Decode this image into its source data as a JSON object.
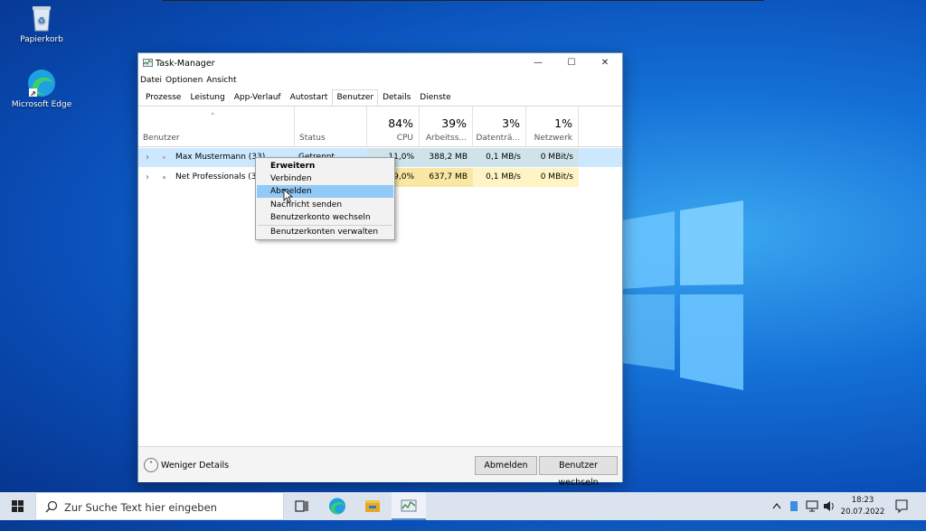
{
  "desktop": {
    "icons": [
      {
        "label": "Papierkorb"
      },
      {
        "label": "Microsoft Edge"
      }
    ]
  },
  "window": {
    "title": "Task-Manager",
    "controls": {
      "minimize": "—",
      "maximize": "☐",
      "close": "✕"
    }
  },
  "menu": [
    "Datei",
    "Optionen",
    "Ansicht"
  ],
  "tabs": [
    {
      "label": "Prozesse",
      "active": false
    },
    {
      "label": "Leistung",
      "active": false
    },
    {
      "label": "App-Verlauf",
      "active": false
    },
    {
      "label": "Autostart",
      "active": false
    },
    {
      "label": "Benutzer",
      "active": true
    },
    {
      "label": "Details",
      "active": false
    },
    {
      "label": "Dienste",
      "active": false
    }
  ],
  "columns": {
    "user": "Benutzer",
    "status": "Status",
    "cpu": {
      "percent": "84%",
      "label": "CPU"
    },
    "memory": {
      "percent": "39%",
      "label": "Arbeitss..."
    },
    "disk": {
      "percent": "3%",
      "label": "Datenträ..."
    },
    "network": {
      "percent": "1%",
      "label": "Netzwerk"
    }
  },
  "rows": [
    {
      "name": "Max Mustermann (33)",
      "status": "Getrennt",
      "cpu": "11,0%",
      "memory": "388,2 MB",
      "disk": "0,1 MB/s",
      "network": "0 MBit/s"
    },
    {
      "name": "Net Professionals (30)",
      "status": "",
      "cpu": "9,0%",
      "memory": "637,7 MB",
      "disk": "0,1 MB/s",
      "network": "0 MBit/s"
    }
  ],
  "context_menu": [
    {
      "label": "Erweitern",
      "bold": true
    },
    {
      "label": "Verbinden"
    },
    {
      "label": "Abmelden",
      "highlighted": true
    },
    {
      "label": "Nachricht senden"
    },
    {
      "label": "Benutzerkonto wechseln"
    },
    {
      "label": "Benutzerkonten verwalten"
    }
  ],
  "footer": {
    "less_details": "Weniger Details",
    "logoff_button": "Abmelden",
    "switch_user_button": "Benutzer wechseln"
  },
  "taskbar": {
    "search_placeholder": "Zur Suche Text hier eingeben",
    "time": "18:23",
    "date": "20.07.2022"
  },
  "colors": {
    "cpu_high": "#f9e7a3",
    "cpu_low": "#fff4c4",
    "selection": "#cce8ff",
    "menu_highlight": "#91c9f7"
  }
}
